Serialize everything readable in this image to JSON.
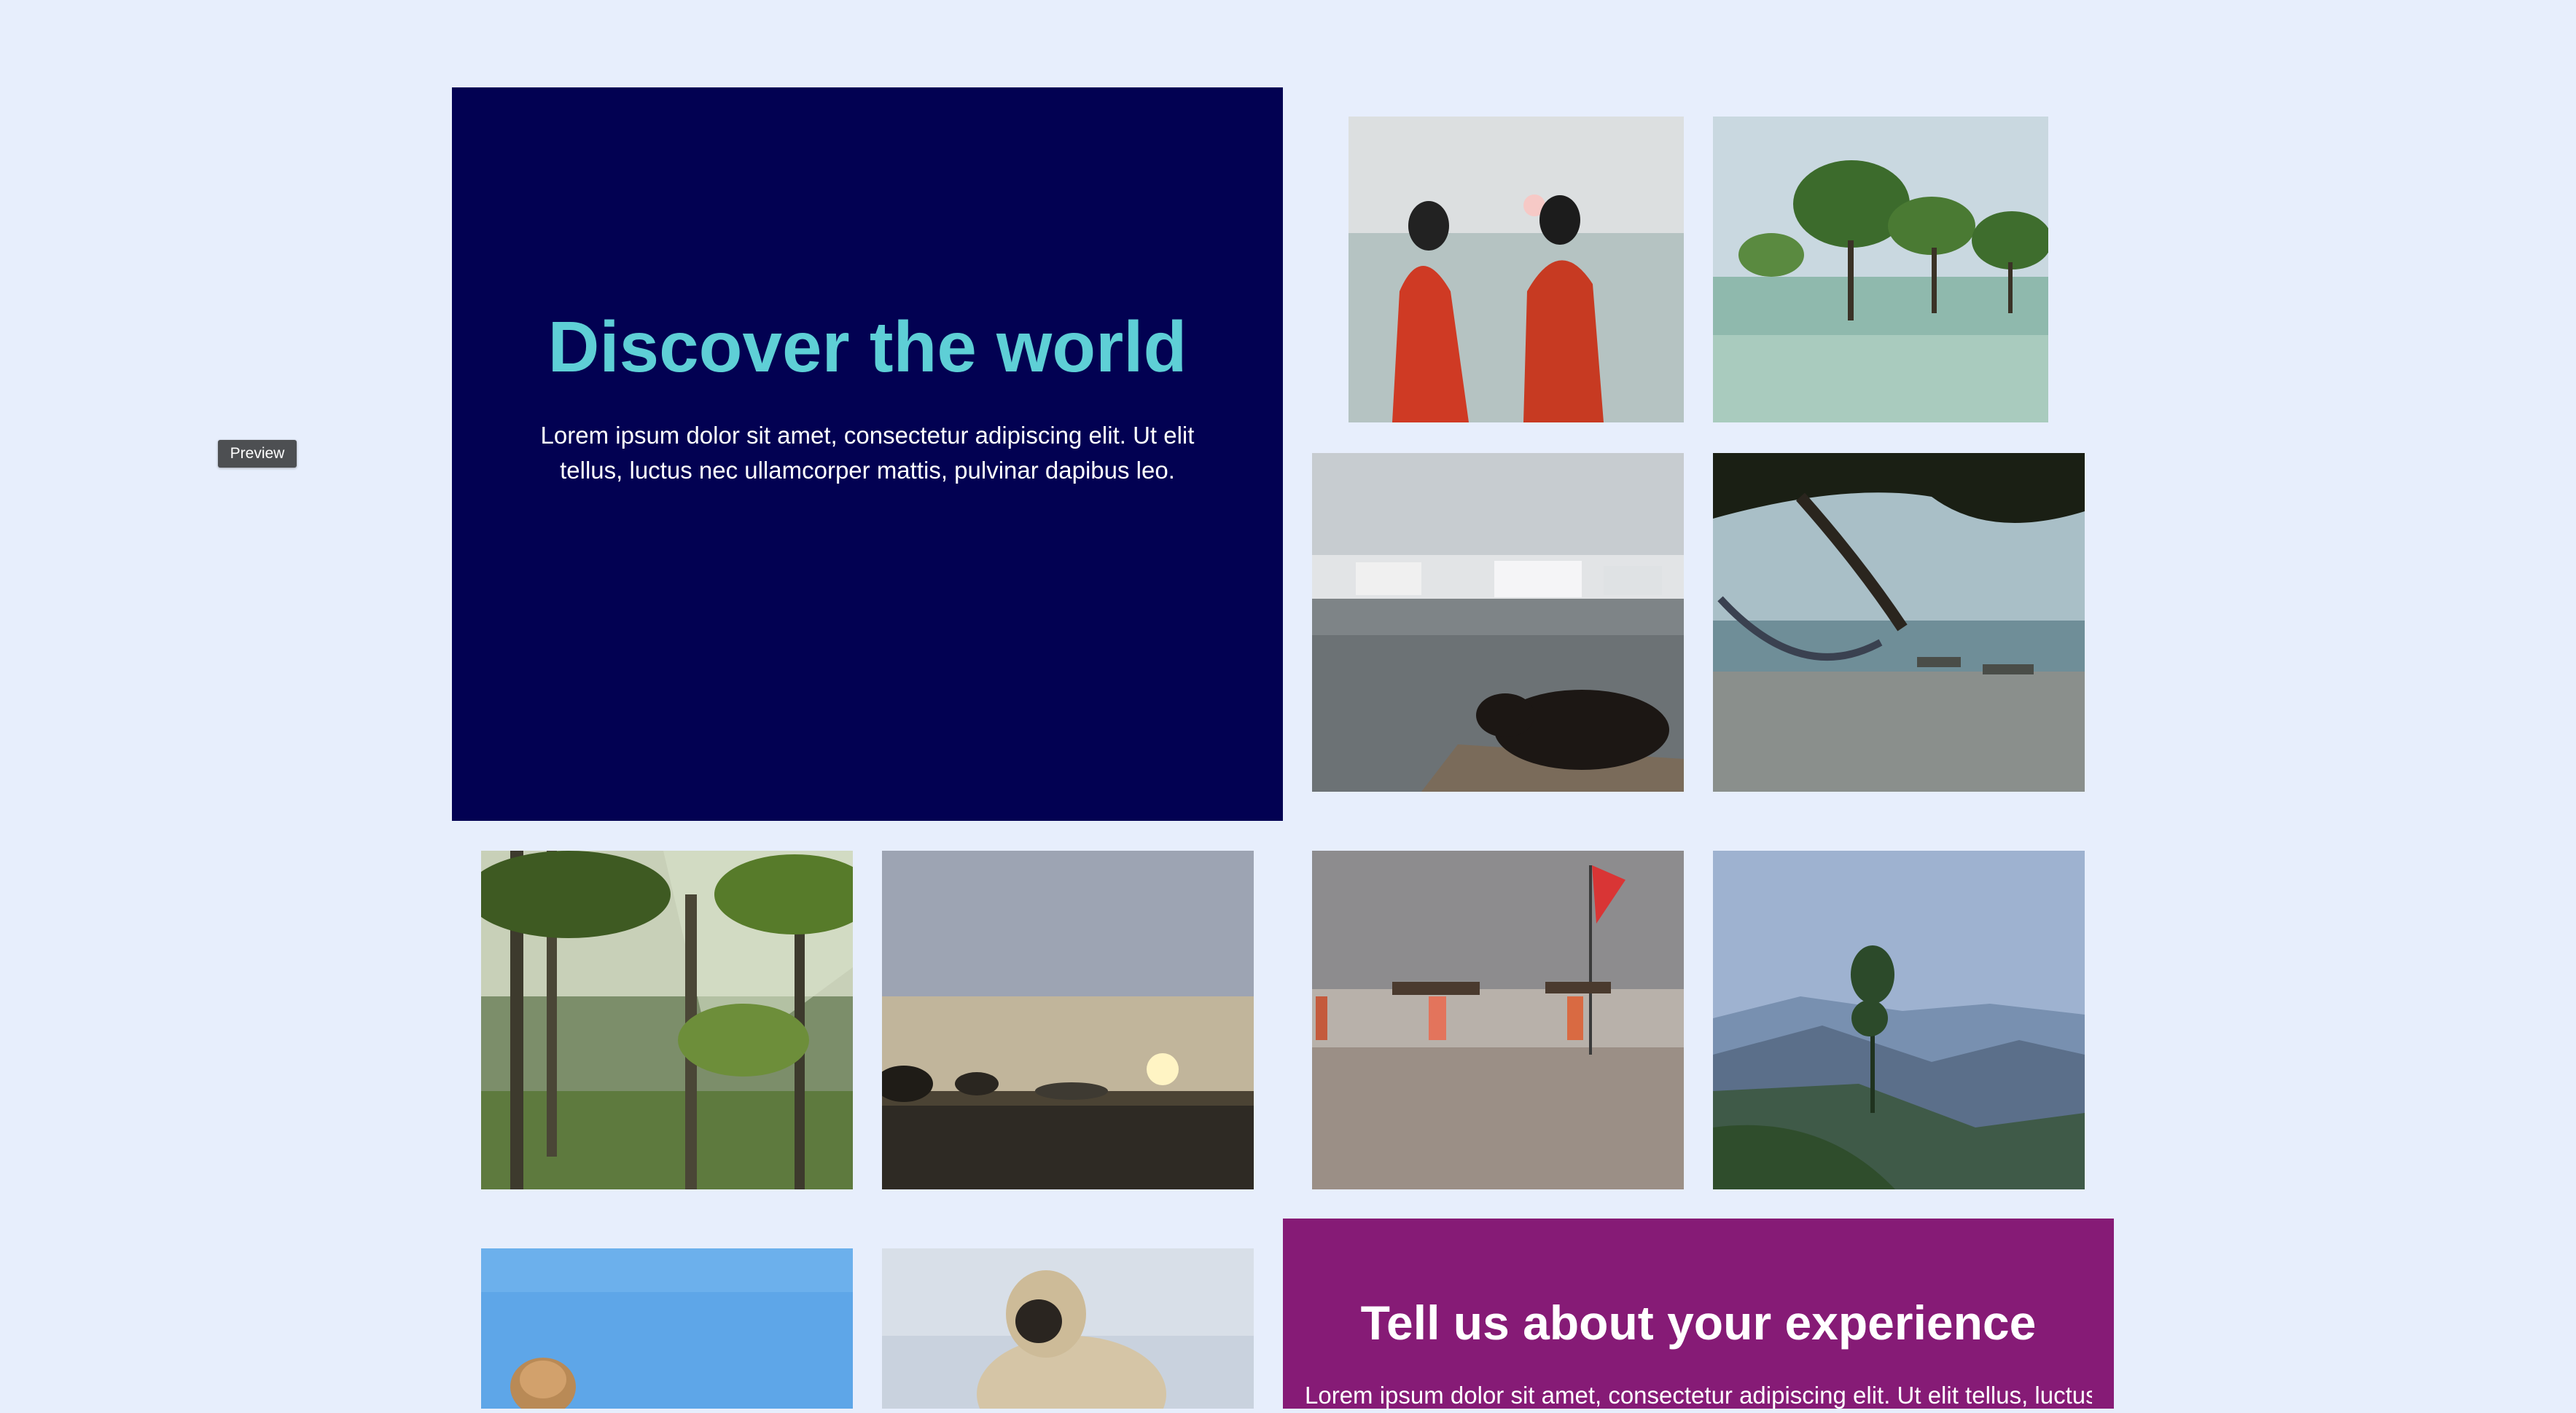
{
  "preview_label": "Preview",
  "hero": {
    "title": "Discover the world",
    "text": "Lorem ipsum dolor sit amet, consectetur adipiscing elit. Ut elit tellus, luctus nec ullamcorper mattis, pulvinar dapibus leo.",
    "background_color": "#020152",
    "title_color": "#5ecfd6"
  },
  "cta": {
    "title": "Tell us about your experience",
    "text": "Lorem ipsum dolor sit amet, consectetur adipiscing elit. Ut elit tellus, luctus",
    "background_color": "#861b76"
  },
  "gallery": [
    {
      "name": "photo-women-sunset-sea"
    },
    {
      "name": "photo-mangrove-trees"
    },
    {
      "name": "photo-cow-lakeside-town"
    },
    {
      "name": "photo-hammock-beach"
    },
    {
      "name": "photo-palm-forest"
    },
    {
      "name": "photo-sunset-tidal-flat"
    },
    {
      "name": "photo-beach-wood-carriers"
    },
    {
      "name": "photo-misty-mountains"
    },
    {
      "name": "photo-blue-wall-shell"
    },
    {
      "name": "photo-langur-monkey"
    }
  ],
  "page_background": "#e7eefc"
}
